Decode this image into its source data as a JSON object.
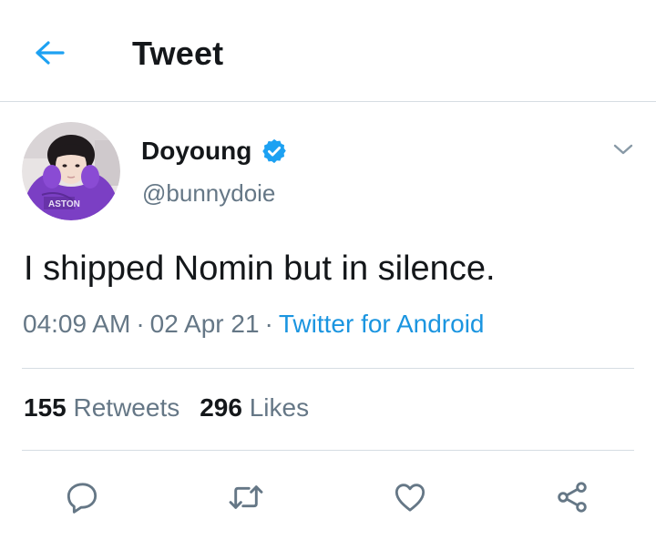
{
  "header": {
    "title": "Tweet",
    "back_icon": "arrow-left-icon"
  },
  "author": {
    "display_name": "Doyoung",
    "handle": "@bunnydoie",
    "verified": true,
    "avatar_text": "ASTON"
  },
  "tweet": {
    "text": "I shipped Nomin but in silence.",
    "time": "04:09 AM",
    "date": "02 Apr 21",
    "separator": "·",
    "source": "Twitter for Android"
  },
  "stats": {
    "retweets_count": "155",
    "retweets_label": "Retweets",
    "likes_count": "296",
    "likes_label": "Likes"
  },
  "actions": [
    "reply-icon",
    "retweet-icon",
    "like-icon",
    "share-icon"
  ],
  "colors": {
    "accent": "#1da1f2",
    "link": "#1b95e0",
    "text": "#14171a",
    "secondary": "#657786",
    "divider": "#d6dde3",
    "icon": "#657786"
  }
}
